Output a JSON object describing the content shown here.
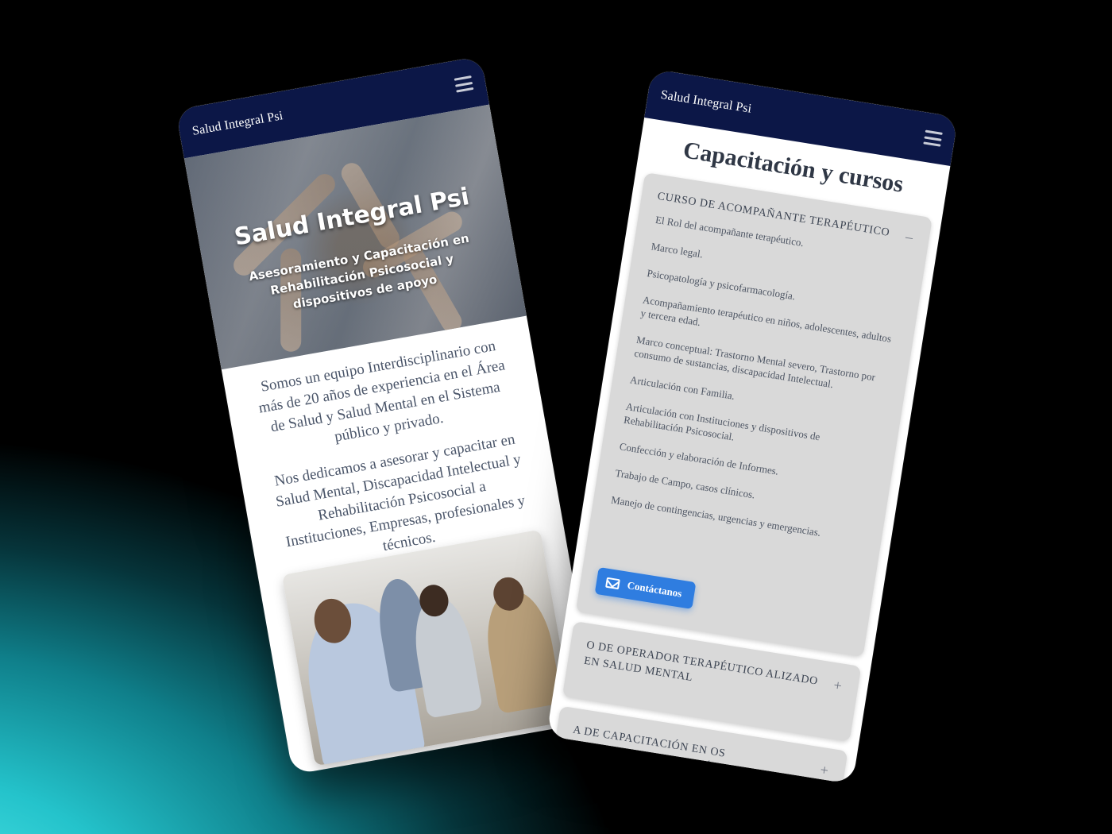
{
  "left_screen": {
    "navbar": {
      "brand": "Salud Integral Psi",
      "menu_icon": "hamburger-menu-icon"
    },
    "hero": {
      "title": "Salud Integral Psi",
      "subtitle": "Asesoramiento y Capacitación en Rehabilitación Psicosocial y dispositivos de apoyo"
    },
    "intro": [
      "Somos un equipo Interdisciplinario con más de 20 años de experiencia en el Área de Salud y Salud Mental en el Sistema público y privado.",
      "Nos dedicamos a asesorar y capacitar en Salud Mental, Discapacidad Intelectual y Rehabilitación Psicosocial a Instituciones, Empresas, profesionales y técnicos."
    ]
  },
  "right_screen": {
    "navbar": {
      "brand": "Salud Integral Psi",
      "menu_icon": "hamburger-menu-icon"
    },
    "page_title": "Capacitación y cursos",
    "courses": [
      {
        "title": "CURSO DE ACOMPAÑANTE TERAPÉUTICO",
        "toggle": "–",
        "topics": [
          "El Rol del acompañante terapéutico.",
          "Marco legal.",
          "Psicopatología y psicofarmacología.",
          "Acompañamiento terapéutico en niños, adolescentes, adultos y tercera edad.",
          "Marco conceptual: Trastorno Mental severo, Trastorno por consumo de sustancias, discapacidad Intelectual.",
          "Articulación con Familia.",
          "Articulación con Instituciones y dispositivos de Rehabilitación Psicosocial.",
          "Confección y elaboración de Informes.",
          "Trabajo de Campo, casos clínicos.",
          "Manejo de contingencias, urgencias y emergencias."
        ],
        "button_label": "Contáctanos"
      },
      {
        "title": "O DE OPERADOR TERAPÉUTICO ALIZADO EN SALUD MENTAL",
        "toggle": "+"
      },
      {
        "title": "A DE CAPACITACIÓN EN OS RESIDENCIALES DE ACIÓN PSICOSOCIAL ADO A PROFESIONALES DE LA",
        "toggle": "+"
      }
    ]
  },
  "colors": {
    "navbar": "#0c1747",
    "accent_button": "#2f7de0",
    "card_bg": "#d9d9d9",
    "background_glow": "#24c3cb"
  }
}
